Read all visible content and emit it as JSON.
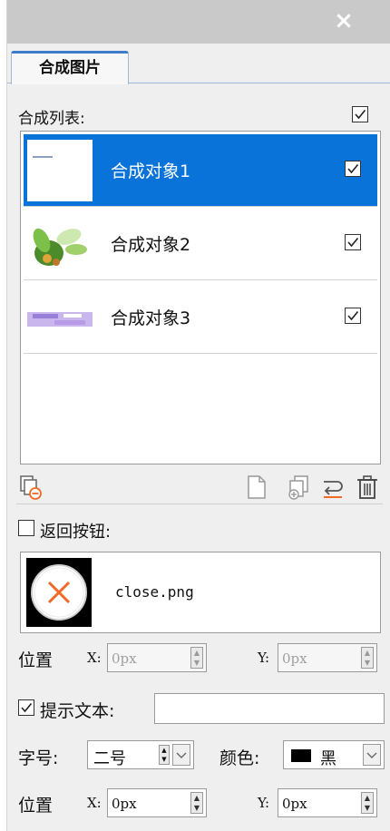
{
  "window": {
    "close_label": "×"
  },
  "tab": {
    "label": "合成图片"
  },
  "composite_list": {
    "header_label": "合成列表:",
    "all_checked": true,
    "items": [
      {
        "label": "合成对象1",
        "checked": true,
        "selected": true,
        "thumb_icon": "white-page-thumbnail"
      },
      {
        "label": "合成对象2",
        "checked": true,
        "selected": false,
        "thumb_icon": "green-flower-thumbnail"
      },
      {
        "label": "合成对象3",
        "checked": true,
        "selected": false,
        "thumb_icon": "purple-banner-thumbnail"
      }
    ]
  },
  "toolbar": {
    "icons": [
      "copy-remove-icon",
      "new-page-icon",
      "duplicate-add-icon",
      "replace-icon",
      "delete-icon"
    ]
  },
  "back_button": {
    "label": "返回按钮:",
    "checked": false,
    "image_name": "close.png",
    "image_icon": "close-circle-icon"
  },
  "position_1": {
    "label": "位置",
    "x_label": "X:",
    "x_value": "0px",
    "y_label": "Y:",
    "y_value": "0px",
    "enabled": false
  },
  "tip_text": {
    "label": "提示文本:",
    "checked": true,
    "value": ""
  },
  "font": {
    "size_label": "字号:",
    "size_value": "二号",
    "color_label": "颜色:",
    "color_value": "黑",
    "color_hex": "#000000"
  },
  "position_2": {
    "label": "位置",
    "x_label": "X:",
    "x_value": "0px",
    "y_label": "Y:",
    "y_value": "0px",
    "enabled": true
  },
  "colors": {
    "accent": "#0a73d9",
    "tab_accent": "#3d7cc9",
    "cancel_orange": "#f06a25"
  }
}
